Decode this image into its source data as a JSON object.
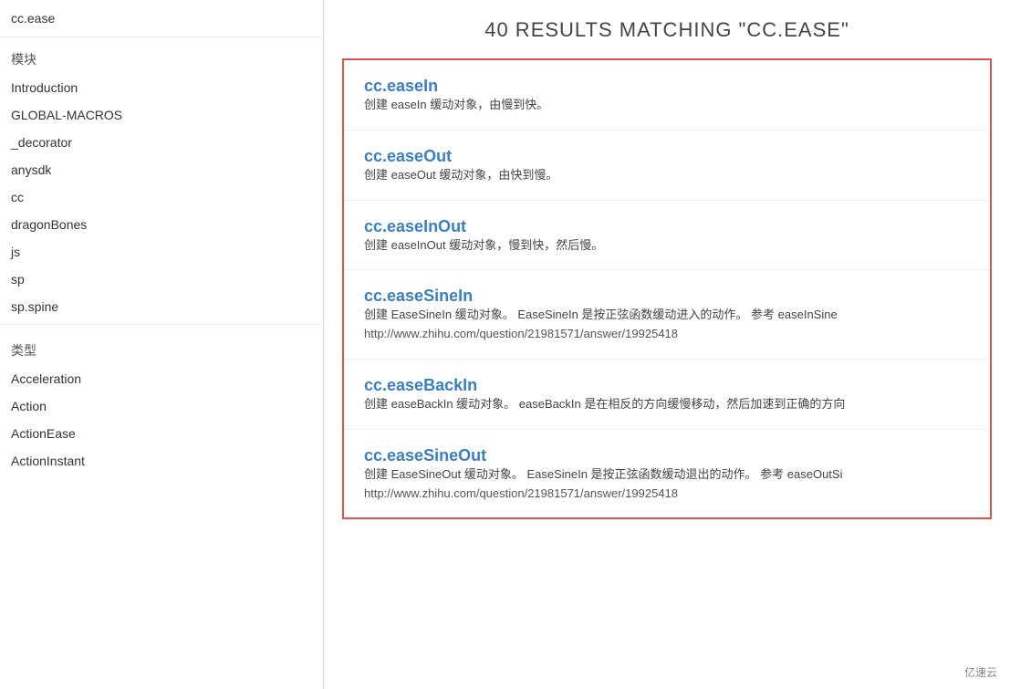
{
  "sidebar": {
    "search_value": "cc.ease",
    "section_modules": "模块",
    "section_types": "类型",
    "module_items": [
      "Introduction",
      "GLOBAL-MACROS",
      "_decorator",
      "anysdk",
      "cc",
      "dragonBones",
      "js",
      "sp",
      "sp.spine"
    ],
    "type_items": [
      "Acceleration",
      "Action",
      "ActionEase",
      "ActionInstant"
    ]
  },
  "main": {
    "results_header": "40 RESULTS MATCHING \"CC.EASE\"",
    "results": [
      {
        "title": "cc.easeIn",
        "desc": "创建 easeIn 缓动对象，由慢到快。",
        "link": ""
      },
      {
        "title": "cc.easeOut",
        "desc": "创建 easeOut 缓动对象，由快到慢。",
        "link": ""
      },
      {
        "title": "cc.easeInOut",
        "desc": "创建 easeInOut 缓动对象，慢到快，然后慢。",
        "link": ""
      },
      {
        "title": "cc.easeSineIn",
        "desc": "创建 EaseSineIn 缓动对象。 EaseSineIn 是按正弦函数缓动进入的动作。 参考 easeInSine",
        "link": "http://www.zhihu.com/question/21981571/answer/19925418"
      },
      {
        "title": "cc.easeBackIn",
        "desc": "创建 easeBackIn 缓动对象。 easeBackIn 是在相反的方向缓慢移动，然后加速到正确的方向",
        "link": ""
      },
      {
        "title": "cc.easeSineOut",
        "desc": "创建 EaseSineOut 缓动对象。 EaseSineIn 是按正弦函数缓动退出的动作。 参考 easeOutSi",
        "link": "http://www.zhihu.com/question/21981571/answer/19925418"
      }
    ]
  },
  "watermark": "亿速云"
}
